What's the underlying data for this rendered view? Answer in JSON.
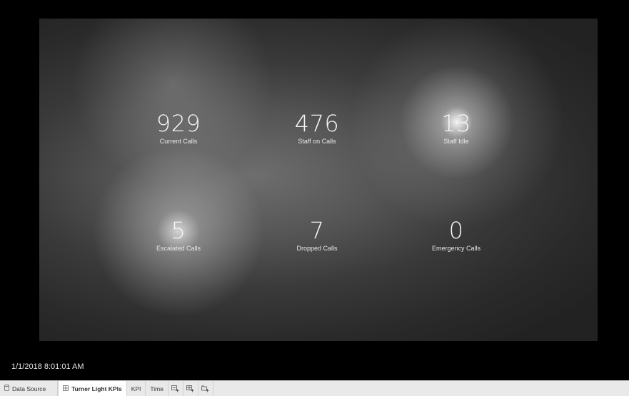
{
  "dashboard": {
    "kpis": [
      {
        "value": "929",
        "label": "Current Calls"
      },
      {
        "value": "476",
        "label": "Staff on Calls"
      },
      {
        "value": "13",
        "label": "Staff Idle"
      },
      {
        "value": "5",
        "label": "Escalated Calls"
      },
      {
        "value": "7",
        "label": "Dropped Calls"
      },
      {
        "value": "0",
        "label": "Emergency Calls"
      }
    ]
  },
  "timestamp": "1/1/2018 8:01:01 AM",
  "tabbar": {
    "data_source_label": "Data Source",
    "tabs": [
      {
        "label": "Turner Light KPIs",
        "active": true
      },
      {
        "label": "KPI",
        "active": false
      },
      {
        "label": "Time",
        "active": false
      }
    ],
    "icons": [
      "new-worksheet-icon",
      "new-dashboard-icon",
      "new-story-icon"
    ]
  }
}
